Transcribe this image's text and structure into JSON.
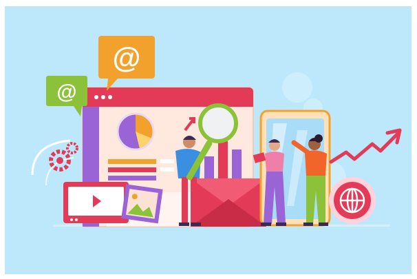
{
  "scene": {
    "kind": "illustration",
    "theme": "digital-marketing",
    "palette": {
      "background": "#bde8fb",
      "accent_red": "#e23a57",
      "accent_orange": "#f2a22c",
      "accent_green": "#8cc13a",
      "accent_purple": "#9a63d6",
      "panel": "#ffe9de"
    }
  },
  "bubbles": {
    "large": {
      "glyph": "@"
    },
    "small": {
      "glyph": "@"
    }
  },
  "icons": [
    "email-at-bubble-icon",
    "email-at-bubble-icon",
    "gear-icon",
    "magnifier-icon",
    "envelope-icon",
    "globe-icon",
    "trend-arrow-icon",
    "video-play-icon",
    "image-icon",
    "pie-chart-icon"
  ]
}
